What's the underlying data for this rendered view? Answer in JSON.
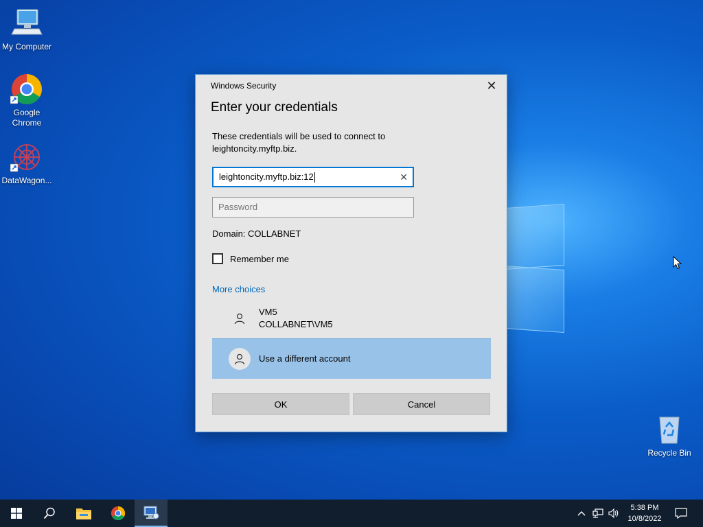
{
  "desktop": {
    "icons": [
      {
        "label": "My Computer"
      },
      {
        "label": "Google Chrome"
      },
      {
        "label": "DataWagon..."
      },
      {
        "label": "Recycle Bin"
      }
    ]
  },
  "dialog": {
    "window_title": "Windows Security",
    "heading": "Enter your credentials",
    "description": "These credentials will be used to connect to leightoncity.myftp.biz.",
    "username_value": "leightoncity.myftp.biz:12",
    "password_placeholder": "Password",
    "domain_text": "Domain: COLLABNET",
    "remember_label": "Remember me",
    "remember_checked": false,
    "more_choices_label": "More choices",
    "accounts": [
      {
        "line1": "VM5",
        "line2": "COLLABNET\\VM5"
      },
      {
        "line1": "Use a different account",
        "selected": true
      }
    ],
    "ok_label": "OK",
    "cancel_label": "Cancel",
    "close_icon": "close-icon"
  },
  "taskbar": {
    "items": [
      "start-icon",
      "search-icon",
      "file-explorer-icon",
      "chrome-icon",
      "remote-desktop-icon"
    ],
    "tray_icons": [
      "chevron-up-icon",
      "network-icon",
      "volume-icon",
      "notification-icon"
    ],
    "clock_time": "5:38 PM",
    "clock_date": "10/8/2022"
  },
  "colors": {
    "accent": "#0078d7",
    "link": "#0067b8",
    "selected_row": "#99c2e8",
    "taskbar": "#101e2e"
  }
}
